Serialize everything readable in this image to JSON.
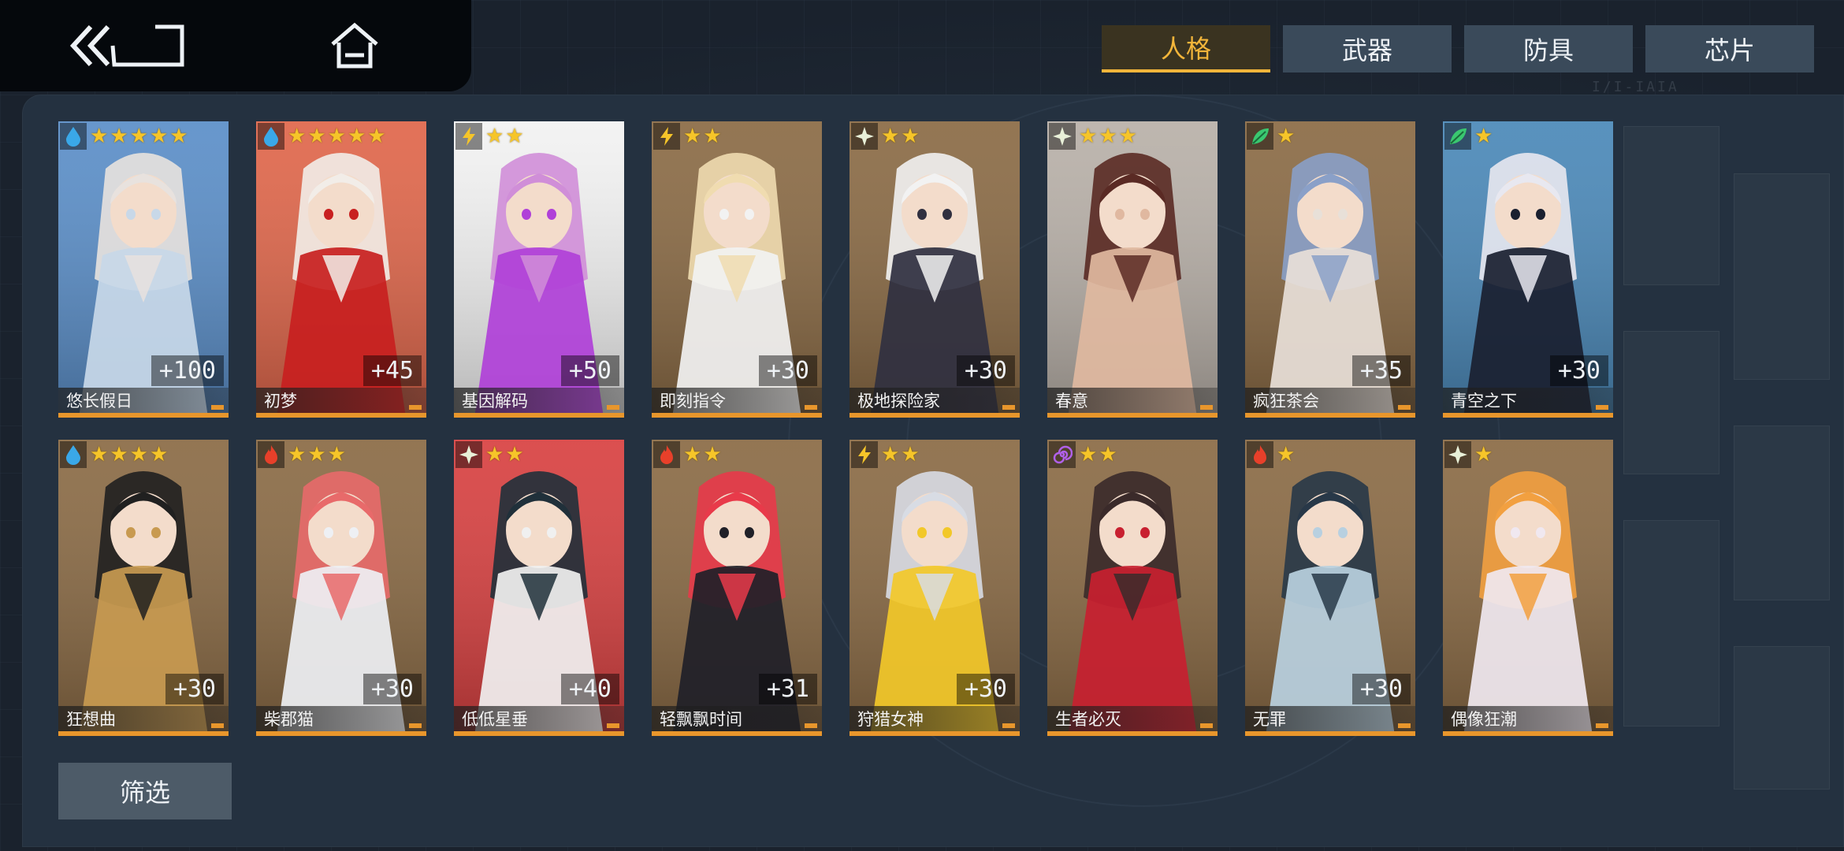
{
  "tabs": [
    {
      "label": "人格",
      "active": true
    },
    {
      "label": "武器",
      "active": false
    },
    {
      "label": "防具",
      "active": false
    },
    {
      "label": "芯片",
      "active": false
    }
  ],
  "filter_label": "筛选",
  "accent_color": "#f3b53a",
  "cards": [
    {
      "name": "悠长假日",
      "level": "+100",
      "stars": 5,
      "attribute": "water-drop-icon",
      "palette": [
        "#5a8ec8",
        "#e8e2de",
        "#c8d8e8"
      ]
    },
    {
      "name": "初梦",
      "level": "+45",
      "stars": 5,
      "attribute": "water-drop-icon",
      "palette": [
        "#e0664a",
        "#f2ede8",
        "#c82020"
      ]
    },
    {
      "name": "基因解码",
      "level": "+50",
      "stars": 2,
      "attribute": "lightning-icon",
      "palette": [
        "#f2f2f2",
        "#d08ed8",
        "#b040d8"
      ]
    },
    {
      "name": "即刻指令",
      "level": "+30",
      "stars": 2,
      "attribute": "lightning-icon",
      "palette": [
        "#8a6a44",
        "#f0dcb0",
        "#f2f2f2"
      ]
    },
    {
      "name": "极地探险家",
      "level": "+30",
      "stars": 2,
      "attribute": "sparkle-icon",
      "palette": [
        "#8a6a44",
        "#f2f2f2",
        "#303040"
      ]
    },
    {
      "name": "春意",
      "level": "",
      "stars": 3,
      "attribute": "sparkle-icon",
      "palette": [
        "#b8b0a8",
        "#5a2a24",
        "#e0b8a0"
      ]
    },
    {
      "name": "疯狂茶会",
      "level": "+35",
      "stars": 1,
      "attribute": "leaf-icon",
      "palette": [
        "#8a6a44",
        "#8aa0c8",
        "#e8e0d8"
      ]
    },
    {
      "name": "青空之下",
      "level": "+30",
      "stars": 1,
      "attribute": "leaf-icon",
      "palette": [
        "#4a88b8",
        "#e8e8f0",
        "#1a2030"
      ]
    },
    {
      "name": "狂想曲",
      "level": "+30",
      "stars": 4,
      "attribute": "water-drop-icon",
      "palette": [
        "#8a6a44",
        "#202020",
        "#c89a50"
      ]
    },
    {
      "name": "柴郡猫",
      "level": "+30",
      "stars": 3,
      "attribute": "fire-icon",
      "palette": [
        "#8a6a44",
        "#e86a6a",
        "#eef0f4"
      ]
    },
    {
      "name": "低低星垂",
      "level": "+40",
      "stars": 2,
      "attribute": "sparkle-icon",
      "palette": [
        "#d84040",
        "#20303a",
        "#f0f0f0"
      ]
    },
    {
      "name": "轻飘飘时间",
      "level": "+31",
      "stars": 2,
      "attribute": "fire-icon",
      "palette": [
        "#8a6a44",
        "#e83a4a",
        "#202028"
      ]
    },
    {
      "name": "狩猎女神",
      "level": "+30",
      "stars": 2,
      "attribute": "lightning-icon",
      "palette": [
        "#8a6a44",
        "#d8dce4",
        "#f2c829"
      ]
    },
    {
      "name": "生者必灭",
      "level": "",
      "stars": 2,
      "attribute": "spiral-icon",
      "palette": [
        "#8a6a44",
        "#3a2a2a",
        "#c82030"
      ]
    },
    {
      "name": "无罪",
      "level": "+30",
      "stars": 1,
      "attribute": "fire-icon",
      "palette": [
        "#8a6a44",
        "#283848",
        "#b8d0e0"
      ]
    },
    {
      "name": "偶像狂潮",
      "level": "",
      "stars": 1,
      "attribute": "sparkle-icon",
      "palette": [
        "#8a6a44",
        "#f2a040",
        "#f0e8f0"
      ]
    }
  ]
}
